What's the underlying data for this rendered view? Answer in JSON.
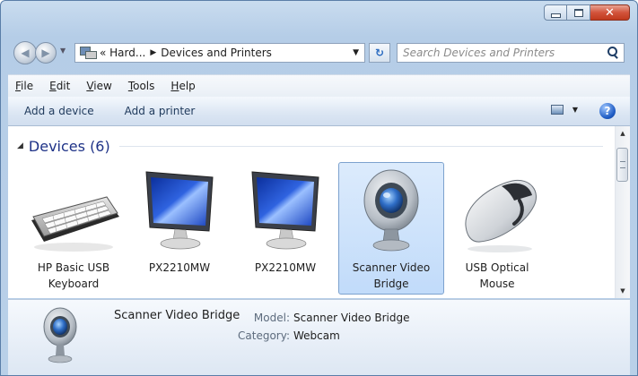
{
  "navigation": {
    "breadcrumbs": [
      "« Hard...",
      "Devices and Printers"
    ],
    "search_placeholder": "Search Devices and Printers"
  },
  "menubar": {
    "items": [
      {
        "underline": "F",
        "rest": "ile"
      },
      {
        "underline": "E",
        "rest": "dit"
      },
      {
        "underline": "V",
        "rest": "iew"
      },
      {
        "underline": "T",
        "rest": "ools"
      },
      {
        "underline": "H",
        "rest": "elp"
      }
    ]
  },
  "commandbar": {
    "add_device": "Add a device",
    "add_printer": "Add a printer"
  },
  "devices": {
    "group_title": "Devices (6)",
    "items": [
      {
        "label": "HP Basic USB Keyboard",
        "icon": "keyboard-icon"
      },
      {
        "label": "PX2210MW",
        "icon": "monitor-icon"
      },
      {
        "label": "PX2210MW",
        "icon": "monitor-icon"
      },
      {
        "label": "Scanner Video Bridge",
        "icon": "webcam-icon",
        "selected": true
      },
      {
        "label": "USB Optical Mouse",
        "icon": "mouse-icon"
      }
    ]
  },
  "details": {
    "name": "Scanner Video Bridge",
    "model_label": "Model:",
    "model_value": "Scanner Video Bridge",
    "category_label": "Category:",
    "category_value": "Webcam"
  },
  "colors": {
    "frame": "#b9d0e8",
    "group_title": "#1e3287",
    "selection": "#c1dbfa"
  }
}
